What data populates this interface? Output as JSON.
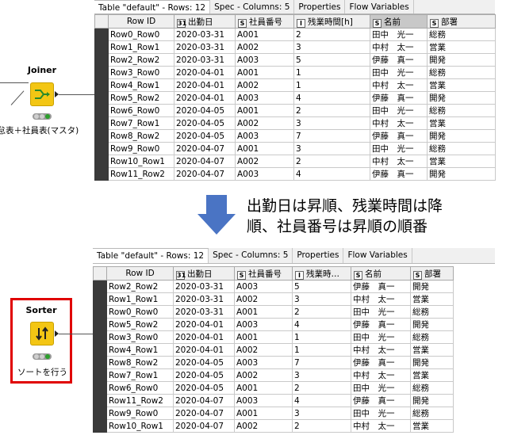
{
  "top": {
    "node": {
      "title": "Joiner",
      "caption": "勤怠表＋社員表(マスタ)"
    },
    "tabs": [
      "Table \"default\" - Rows: 12",
      "Spec - Columns: 5",
      "Properties",
      "Flow Variables"
    ],
    "columns": [
      {
        "type": "",
        "label": "Row ID"
      },
      {
        "type": "31",
        "label": "出勤日"
      },
      {
        "type": "S",
        "label": "社員番号"
      },
      {
        "type": "I",
        "label": "残業時間[h]"
      },
      {
        "type": "S",
        "label": "名前"
      },
      {
        "type": "S",
        "label": "部署"
      }
    ],
    "rows": [
      [
        "Row0_Row0",
        "2020-03-31",
        "A001",
        "2",
        "田中　光一",
        "総務"
      ],
      [
        "Row1_Row1",
        "2020-03-31",
        "A002",
        "3",
        "中村　太一",
        "営業"
      ],
      [
        "Row2_Row2",
        "2020-03-31",
        "A003",
        "5",
        "伊藤　真一",
        "開発"
      ],
      [
        "Row3_Row0",
        "2020-04-01",
        "A001",
        "1",
        "田中　光一",
        "総務"
      ],
      [
        "Row4_Row1",
        "2020-04-01",
        "A002",
        "1",
        "中村　太一",
        "営業"
      ],
      [
        "Row5_Row2",
        "2020-04-01",
        "A003",
        "4",
        "伊藤　真一",
        "開発"
      ],
      [
        "Row6_Row0",
        "2020-04-05",
        "A001",
        "2",
        "田中　光一",
        "総務"
      ],
      [
        "Row7_Row1",
        "2020-04-05",
        "A002",
        "3",
        "中村　太一",
        "営業"
      ],
      [
        "Row8_Row2",
        "2020-04-05",
        "A003",
        "7",
        "伊藤　真一",
        "開発"
      ],
      [
        "Row9_Row0",
        "2020-04-07",
        "A001",
        "3",
        "田中　光一",
        "総務"
      ],
      [
        "Row10_Row1",
        "2020-04-07",
        "A002",
        "2",
        "中村　太一",
        "営業"
      ],
      [
        "Row11_Row2",
        "2020-04-07",
        "A003",
        "4",
        "伊藤　真一",
        "開発"
      ]
    ]
  },
  "note": {
    "line1": "出勤日は昇順、残業時間は降",
    "line2": "順、社員番号は昇順の順番"
  },
  "bottom": {
    "node": {
      "title": "Sorter",
      "caption": "ソートを行う"
    },
    "tabs": [
      "Table \"default\" - Rows: 12",
      "Spec - Columns: 5",
      "Properties",
      "Flow Variables"
    ],
    "columns": [
      {
        "type": "",
        "label": "Row ID"
      },
      {
        "type": "31",
        "label": "出勤日"
      },
      {
        "type": "S",
        "label": "社員番号"
      },
      {
        "type": "I",
        "label": "残業時…"
      },
      {
        "type": "S",
        "label": "名前"
      },
      {
        "type": "S",
        "label": "部署"
      }
    ],
    "rows": [
      [
        "Row2_Row2",
        "2020-03-31",
        "A003",
        "5",
        "伊藤　真一",
        "開発"
      ],
      [
        "Row1_Row1",
        "2020-03-31",
        "A002",
        "3",
        "中村　太一",
        "営業"
      ],
      [
        "Row0_Row0",
        "2020-03-31",
        "A001",
        "2",
        "田中　光一",
        "総務"
      ],
      [
        "Row5_Row2",
        "2020-04-01",
        "A003",
        "4",
        "伊藤　真一",
        "開発"
      ],
      [
        "Row3_Row0",
        "2020-04-01",
        "A001",
        "1",
        "田中　光一",
        "総務"
      ],
      [
        "Row4_Row1",
        "2020-04-01",
        "A002",
        "1",
        "中村　太一",
        "営業"
      ],
      [
        "Row8_Row2",
        "2020-04-05",
        "A003",
        "7",
        "伊藤　真一",
        "開発"
      ],
      [
        "Row7_Row1",
        "2020-04-05",
        "A002",
        "3",
        "中村　太一",
        "営業"
      ],
      [
        "Row6_Row0",
        "2020-04-05",
        "A001",
        "2",
        "田中　光一",
        "総務"
      ],
      [
        "Row11_Row2",
        "2020-04-07",
        "A003",
        "4",
        "伊藤　真一",
        "開発"
      ],
      [
        "Row9_Row0",
        "2020-04-07",
        "A001",
        "3",
        "田中　光一",
        "総務"
      ],
      [
        "Row10_Row1",
        "2020-04-07",
        "A002",
        "2",
        "中村　太一",
        "営業"
      ]
    ]
  },
  "colors": {
    "accent_arrow": "#4a74c4",
    "highlight": "#e00000",
    "node_yellow": "#f3c614"
  }
}
